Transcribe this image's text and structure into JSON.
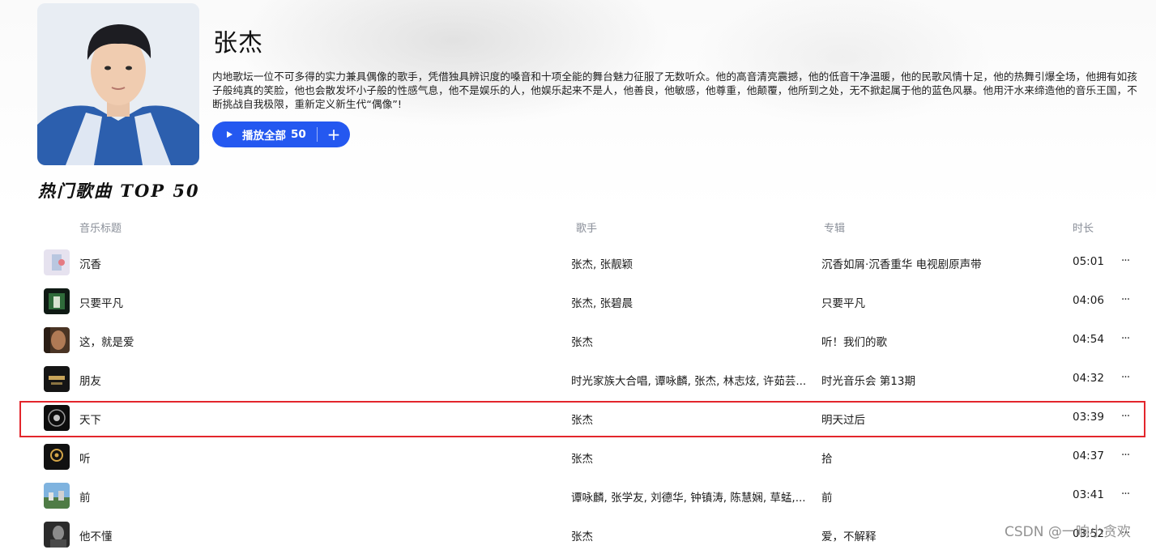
{
  "artist": {
    "name": "张杰",
    "bio": "内地歌坛一位不可多得的实力兼具偶像的歌手，凭借独具辨识度的嗓音和十项全能的舞台魅力征服了无数听众。他的高音清亮震撼，他的低音干净温暖，他的民歌风情十足，他的热舞引爆全场，他拥有如孩子般纯真的笑脸，他也会散发坏小子般的性感气息，他不是娱乐的人，他娱乐起来不是人，他善良，他敏感，他尊重，他颠覆，他所到之处，无不掀起属于他的蓝色风暴。他用汗水来缔造他的音乐王国，不断挑战自我极限，重新定义新生代“偶像”!"
  },
  "play_all": {
    "label": "播放全部",
    "count": "50",
    "add": "+"
  },
  "section_title": "热门歌曲 TOP 50",
  "columns": {
    "title": "音乐标题",
    "artist": "歌手",
    "album": "专辑",
    "duration": "时长"
  },
  "songs": [
    {
      "title": "沉香",
      "artist": "张杰, 张靓颖",
      "album": "沉香如屑·沉香重华 电视剧原声带",
      "duration": "05:01",
      "more": "···"
    },
    {
      "title": "只要平凡",
      "artist": "张杰, 张碧晨",
      "album": "只要平凡",
      "duration": "04:06",
      "more": "···"
    },
    {
      "title": "这，就是爱",
      "artist": "张杰",
      "album": "听！我们的歌",
      "duration": "04:54",
      "more": "···"
    },
    {
      "title": "朋友",
      "artist": "时光家族大合唱, 谭咏麟, 张杰, 林志炫, 许茹芸...",
      "album": "时光音乐会 第13期",
      "duration": "04:32",
      "more": "···"
    },
    {
      "title": "天下",
      "artist": "张杰",
      "album": "明天过后",
      "duration": "03:39",
      "more": "···"
    },
    {
      "title": "听",
      "artist": "张杰",
      "album": "拾",
      "duration": "04:37",
      "more": "···"
    },
    {
      "title": "前",
      "artist": "谭咏麟, 张学友, 刘德华, 钟镇涛, 陈慧娴, 草蜢,...",
      "album": "前",
      "duration": "03:41",
      "more": "···"
    },
    {
      "title": "他不懂",
      "artist": "张杰",
      "album": "爱，不解释",
      "duration": "03:52",
      "more": "···"
    }
  ],
  "watermark": "CSDN @一晌小贪欢",
  "colors": {
    "accent": "#2458f0",
    "highlight": "#e3262c",
    "header_text": "#8a8f99"
  }
}
